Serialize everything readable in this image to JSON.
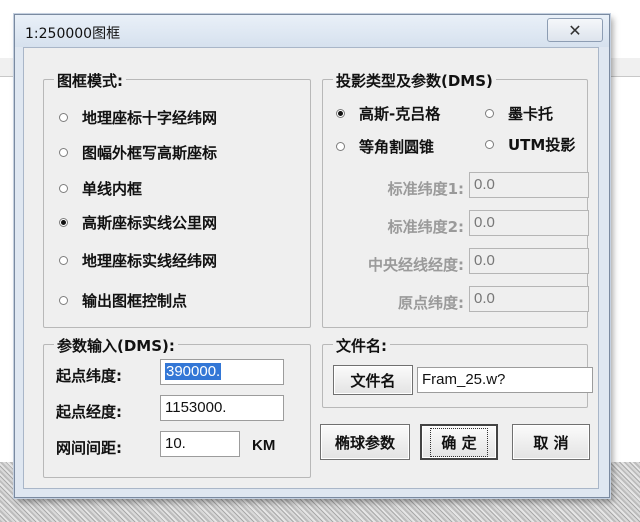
{
  "window": {
    "title": "1:250000图框",
    "close_glyph": "✕"
  },
  "frame_mode": {
    "title": "图框模式:",
    "options": [
      {
        "label": "地理座标十字经纬网",
        "checked": false
      },
      {
        "label": "图幅外框写高斯座标",
        "checked": false
      },
      {
        "label": "单线内框",
        "checked": false
      },
      {
        "label": "高斯座标实线公里网",
        "checked": true
      },
      {
        "label": "地理座标实线经纬网",
        "checked": false
      },
      {
        "label": "输出图框控制点",
        "checked": false
      }
    ]
  },
  "projection": {
    "title": "投影类型及参数(DMS)",
    "options": [
      {
        "label": "高斯-克吕格",
        "checked": true
      },
      {
        "label": "墨卡托",
        "checked": false
      },
      {
        "label": "等角割圆锥",
        "checked": false
      },
      {
        "label": "UTM投影",
        "checked": false
      }
    ],
    "params": [
      {
        "label": "标准纬度1:",
        "value": "0.0"
      },
      {
        "label": "标准纬度2:",
        "value": "0.0"
      },
      {
        "label": "中央经线经度:",
        "value": "0.0"
      },
      {
        "label": "原点纬度:",
        "value": "0.0"
      }
    ]
  },
  "input": {
    "title": "参数输入(DMS):",
    "start_lat_label": "起点纬度:",
    "start_lat_value": "390000.",
    "start_lon_label": "起点经度:",
    "start_lon_value": "1153000.",
    "grid_label": "网间间距:",
    "grid_value": "10.",
    "grid_unit": "KM"
  },
  "file": {
    "title": "文件名:",
    "button": "文件名",
    "value": "Fram_25.w?"
  },
  "buttons": {
    "ellipsoid": "椭球参数",
    "ok": "确 定",
    "cancel": "取 消"
  }
}
